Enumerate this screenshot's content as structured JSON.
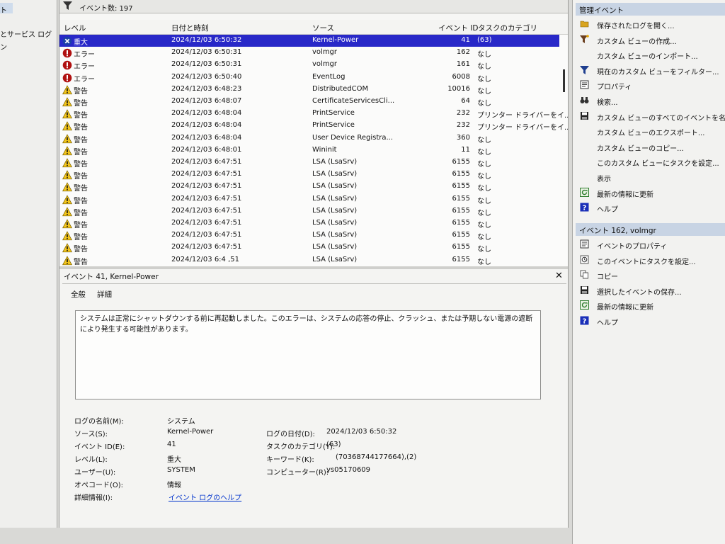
{
  "left_pane": {
    "items": [
      "ト",
      "とサービス ログ",
      "ン"
    ]
  },
  "filter_bar": {
    "event_count": "イベント数: 197"
  },
  "grid": {
    "columns": [
      "レベル",
      "日付と時刻",
      "ソース",
      "イベント ID",
      "タスクのカテゴリ"
    ],
    "rows": [
      {
        "level": "重大",
        "icon": "critical-icon",
        "datetime": "2024/12/03 6:50:32",
        "source": "Kernel-Power",
        "id": "41",
        "category": "(63)",
        "selected": true
      },
      {
        "level": "エラー",
        "icon": "error-icon",
        "datetime": "2024/12/03 6:50:31",
        "source": "volmgr",
        "id": "162",
        "category": "なし"
      },
      {
        "level": "エラー",
        "icon": "error-icon",
        "datetime": "2024/12/03 6:50:31",
        "source": "volmgr",
        "id": "161",
        "category": "なし"
      },
      {
        "level": "エラー",
        "icon": "error-icon",
        "datetime": "2024/12/03 6:50:40",
        "source": "EventLog",
        "id": "6008",
        "category": "なし"
      },
      {
        "level": "警告",
        "icon": "warning-icon",
        "datetime": "2024/12/03 6:48:23",
        "source": "DistributedCOM",
        "id": "10016",
        "category": "なし"
      },
      {
        "level": "警告",
        "icon": "warning-icon",
        "datetime": "2024/12/03 6:48:07",
        "source": "CertificateServicesCli...",
        "id": "64",
        "category": "なし"
      },
      {
        "level": "警告",
        "icon": "warning-icon",
        "datetime": "2024/12/03 6:48:04",
        "source": "PrintService",
        "id": "232",
        "category": "プリンター ドライバーをイ..."
      },
      {
        "level": "警告",
        "icon": "warning-icon",
        "datetime": "2024/12/03 6:48:04",
        "source": "PrintService",
        "id": "232",
        "category": "プリンター ドライバーをイ..."
      },
      {
        "level": "警告",
        "icon": "warning-icon",
        "datetime": "2024/12/03 6:48:04",
        "source": "User Device Registra...",
        "id": "360",
        "category": "なし"
      },
      {
        "level": "警告",
        "icon": "warning-icon",
        "datetime": "2024/12/03 6:48:01",
        "source": "Wininit",
        "id": "11",
        "category": "なし"
      },
      {
        "level": "警告",
        "icon": "warning-icon",
        "datetime": "2024/12/03 6:47:51",
        "source": "LSA (LsaSrv)",
        "id": "6155",
        "category": "なし"
      },
      {
        "level": "警告",
        "icon": "warning-icon",
        "datetime": "2024/12/03 6:47:51",
        "source": "LSA (LsaSrv)",
        "id": "6155",
        "category": "なし"
      },
      {
        "level": "警告",
        "icon": "warning-icon",
        "datetime": "2024/12/03 6:47:51",
        "source": "LSA (LsaSrv)",
        "id": "6155",
        "category": "なし"
      },
      {
        "level": "警告",
        "icon": "warning-icon",
        "datetime": "2024/12/03 6:47:51",
        "source": "LSA (LsaSrv)",
        "id": "6155",
        "category": "なし"
      },
      {
        "level": "警告",
        "icon": "warning-icon",
        "datetime": "2024/12/03 6:47:51",
        "source": "LSA (LsaSrv)",
        "id": "6155",
        "category": "なし"
      },
      {
        "level": "警告",
        "icon": "warning-icon",
        "datetime": "2024/12/03 6:47:51",
        "source": "LSA (LsaSrv)",
        "id": "6155",
        "category": "なし"
      },
      {
        "level": "警告",
        "icon": "warning-icon",
        "datetime": "2024/12/03 6:47:51",
        "source": "LSA (LsaSrv)",
        "id": "6155",
        "category": "なし"
      },
      {
        "level": "警告",
        "icon": "warning-icon",
        "datetime": "2024/12/03 6:47:51",
        "source": "LSA (LsaSrv)",
        "id": "6155",
        "category": "なし"
      },
      {
        "level": "警告",
        "icon": "warning-icon",
        "datetime": "2024/12/03 6:4 ,51",
        "source": "LSA (LsaSrv)",
        "id": "6155",
        "category": "なし"
      }
    ]
  },
  "detail": {
    "title": "イベント 41, Kernel-Power",
    "tabs": [
      "全般",
      "詳細"
    ],
    "description": "システムは正常にシャットダウンする前に再起動しました。このエラーは、システムの応答の停止、クラッシュ、または予期しない電源の遮断により発生する可能性があります。",
    "fields": {
      "log_name": {
        "label": "ログの名前(M):",
        "value": "システム"
      },
      "source": {
        "label": "ソース(S):",
        "value": "Kernel-Power"
      },
      "event_id": {
        "label": "イベント ID(E):",
        "value": "41"
      },
      "level": {
        "label": "レベル(L):",
        "value": "重大"
      },
      "user": {
        "label": "ユーザー(U):",
        "value": "SYSTEM"
      },
      "opcode": {
        "label": "オペコード(O):",
        "value": "情報"
      },
      "more_info": {
        "label": "詳細情報(I):",
        "value": "イベント ログのヘルプ"
      },
      "logged": {
        "label": "ログの日付(D):",
        "value": "2024/12/03 6:50:32"
      },
      "task_category": {
        "label": "タスクのカテゴリ(Y):",
        "value": "(63)"
      },
      "keywords": {
        "label": "キーワード(K):",
        "value": "(70368744177664),(2)"
      },
      "computer": {
        "label": "コンピューター(R):",
        "value": "ys05170609"
      }
    }
  },
  "actions": {
    "section1_title": "管理イベント",
    "section1": [
      {
        "label": "保存されたログを開く...",
        "icon": "open-folder-icon"
      },
      {
        "label": "カスタム ビューの作成...",
        "icon": "filter-create-icon"
      },
      {
        "label": "カスタム ビューのインポート...",
        "icon": ""
      },
      {
        "label": "現在のカスタム ビューをフィルター...",
        "icon": "filter-icon"
      },
      {
        "label": "プロパティ",
        "icon": "properties-icon"
      },
      {
        "label": "検索...",
        "icon": "binoculars-icon"
      },
      {
        "label": "カスタム ビューのすべてのイベントを名前を付け",
        "icon": "save-icon"
      },
      {
        "label": "カスタム ビューのエクスポート...",
        "icon": ""
      },
      {
        "label": "カスタム ビューのコピー...",
        "icon": ""
      },
      {
        "label": "このカスタム ビューにタスクを設定...",
        "icon": ""
      },
      {
        "label": "表示",
        "icon": ""
      },
      {
        "label": "最新の情報に更新",
        "icon": "refresh-icon"
      },
      {
        "label": "ヘルプ",
        "icon": "help-icon"
      }
    ],
    "section2_title": "イベント 162, volmgr",
    "section2": [
      {
        "label": "イベントのプロパティ",
        "icon": "properties-icon"
      },
      {
        "label": "このイベントにタスクを設定...",
        "icon": "task-icon"
      },
      {
        "label": "コピー",
        "icon": "copy-icon"
      },
      {
        "label": "選択したイベントの保存...",
        "icon": "save-icon"
      },
      {
        "label": "最新の情報に更新",
        "icon": "refresh-icon"
      },
      {
        "label": "ヘルプ",
        "icon": "help-icon"
      }
    ]
  }
}
